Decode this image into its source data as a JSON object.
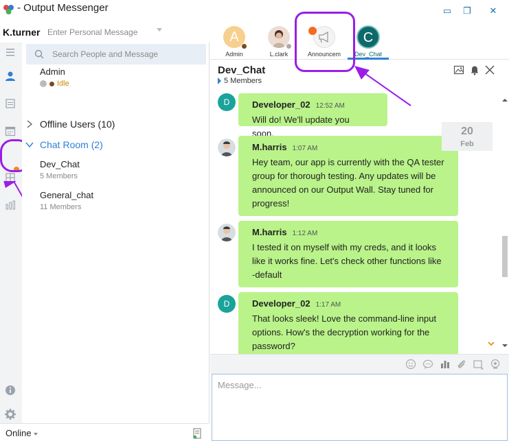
{
  "window": {
    "title": "- Output Messenger",
    "minimize": "▭",
    "restore": "❐",
    "close": "✕"
  },
  "user": {
    "name": "K.turner",
    "personal_message_placeholder": "Enter Personal Message"
  },
  "search": {
    "placeholder": "Search People and Message"
  },
  "contacts": [
    {
      "name": "Admin",
      "status": "Idle"
    }
  ],
  "groups": {
    "offline": "Offline Users (10)",
    "chat_room": "Chat Room (2)"
  },
  "rooms": [
    {
      "name": "Dev_Chat",
      "members": "5 Members"
    },
    {
      "name": "General_chat",
      "members": "11 Members"
    }
  ],
  "footer": {
    "status": "Online"
  },
  "tabs": [
    {
      "label": "Admin",
      "initial": "A",
      "color": "#f7cf8e"
    },
    {
      "label": "L.clark",
      "initial": "",
      "color": "#e9d3c7"
    },
    {
      "label": "Announcem",
      "initial": "",
      "color": "#f2f2f2"
    },
    {
      "label": "Dev_Chat",
      "initial": "C",
      "color": "#0e6a6a"
    }
  ],
  "chat": {
    "title": "Dev_Chat",
    "members": "5 Members"
  },
  "date_chip": {
    "day": "20",
    "month": "Feb"
  },
  "messages": [
    {
      "sender": "Developer_02",
      "time": "12:52 AM",
      "text": "Will do! We'll update you soon.",
      "avatar": "D"
    },
    {
      "sender": "M.harris",
      "time": "1:07 AM",
      "text": "Hey team, our app is currently with the QA tester group for thorough testing. Any updates will be announced on our Output Wall. Stay tuned for progress!",
      "avatar": ""
    },
    {
      "sender": "M.harris",
      "time": "1:12 AM",
      "text": "I tested it on myself with my creds, and it looks like it works fine. Let's check other functions like -default",
      "avatar": ""
    },
    {
      "sender": "Developer_02",
      "time": "1:17 AM",
      "text": "That looks sleek! Love the command-line input options. How's the decryption working for the password?",
      "avatar": "D"
    }
  ],
  "compose": {
    "placeholder": "Message..."
  },
  "colors": {
    "accent": "#2f7fd6",
    "bubble": "#b9f38a",
    "highlight": "#9b1de6",
    "idle": "#c98a00"
  }
}
